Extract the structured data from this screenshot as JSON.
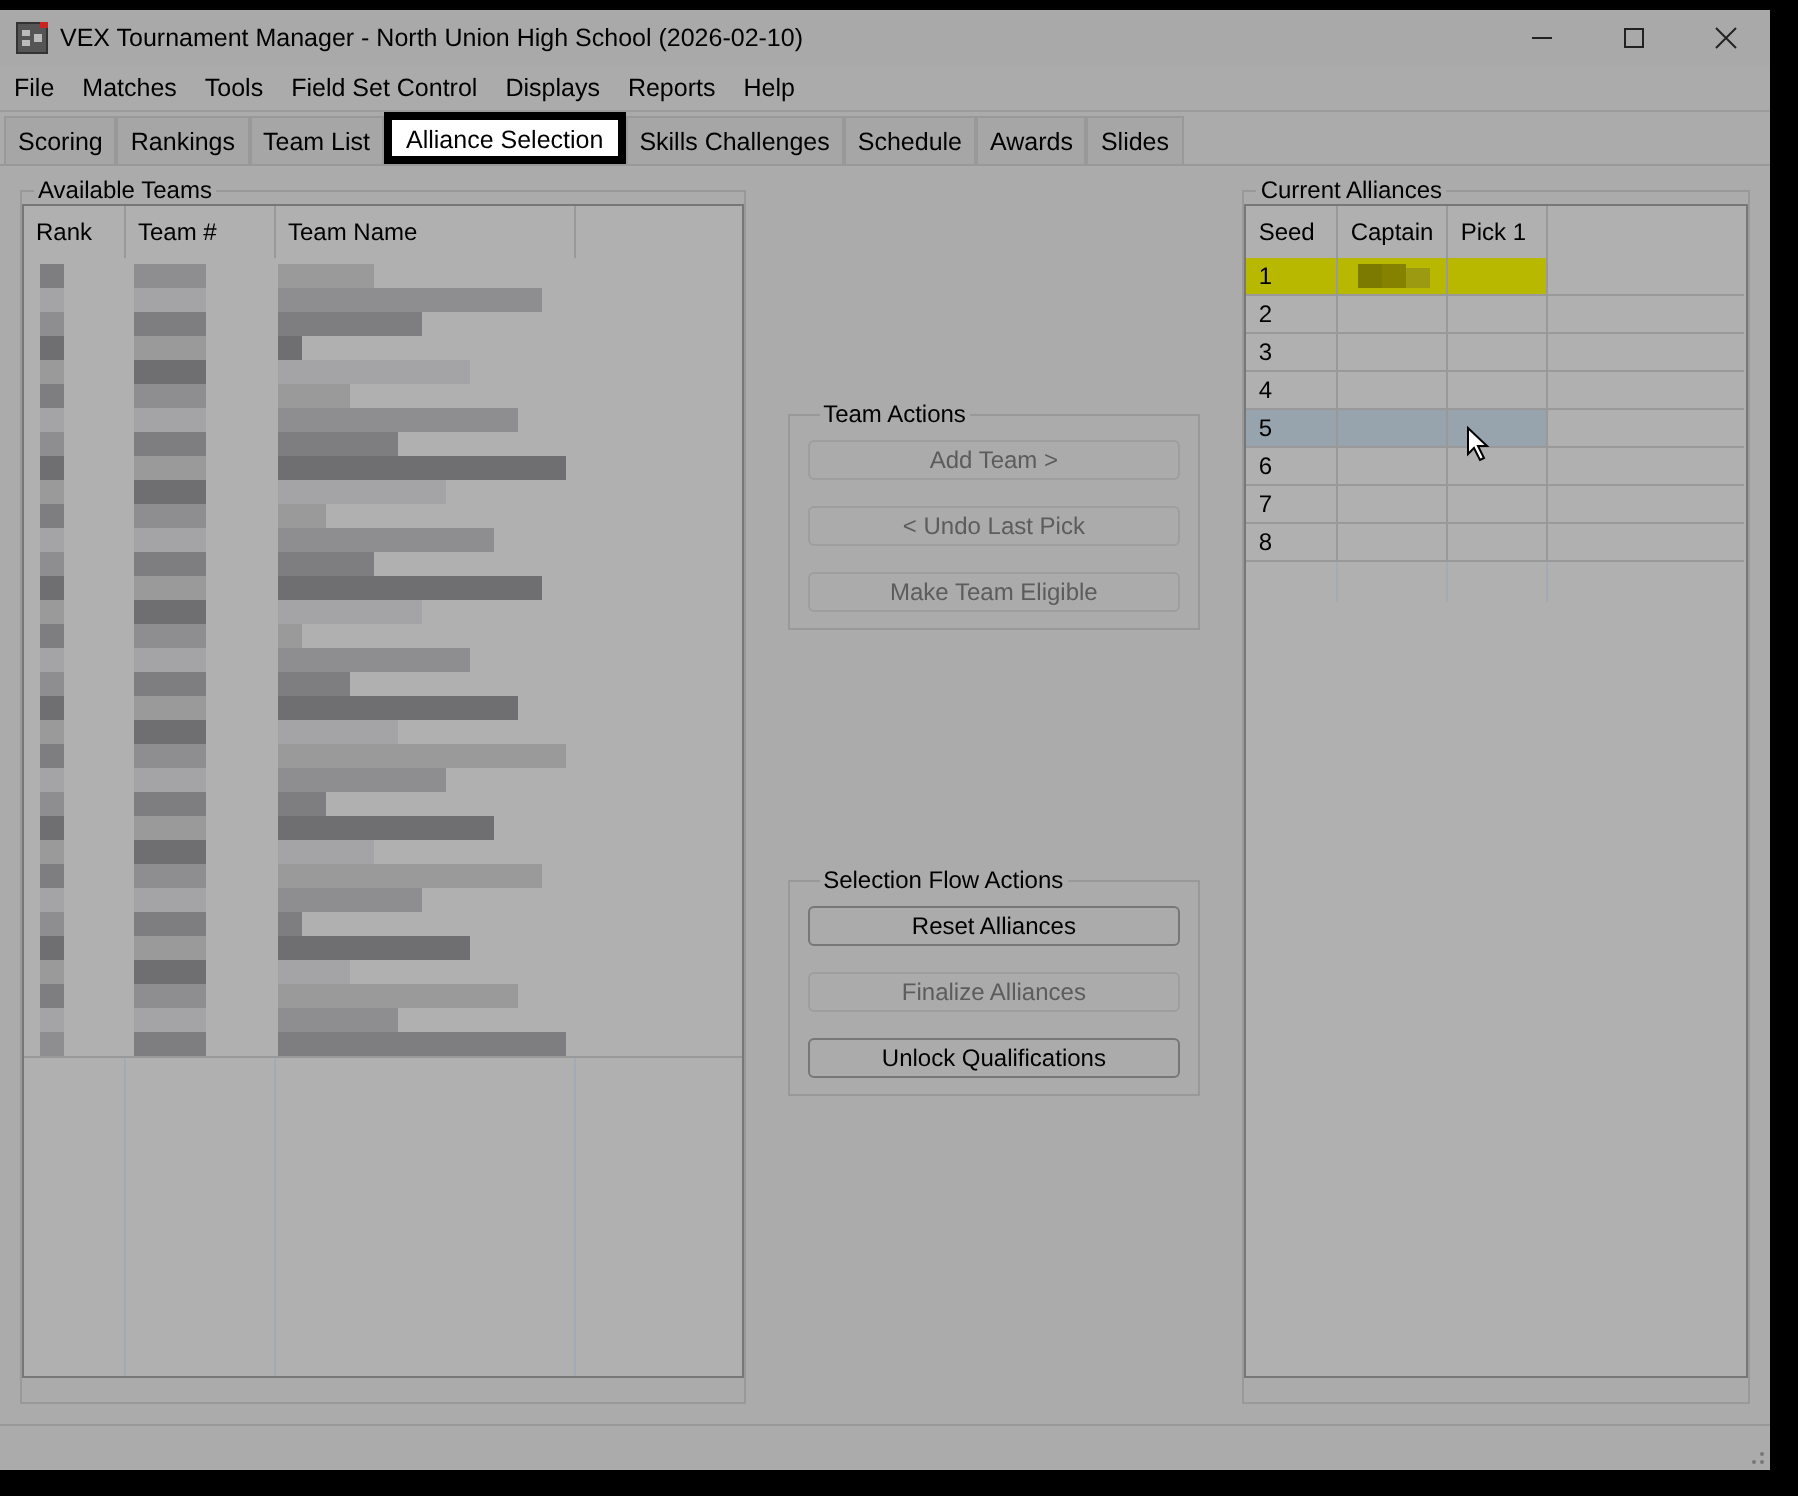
{
  "window": {
    "title": "VEX Tournament Manager - North Union High School (2026-02-10)"
  },
  "menu": [
    "File",
    "Matches",
    "Tools",
    "Field Set Control",
    "Displays",
    "Reports",
    "Help"
  ],
  "tabs": [
    {
      "label": "Scoring",
      "selected": false
    },
    {
      "label": "Rankings",
      "selected": false
    },
    {
      "label": "Team List",
      "selected": false
    },
    {
      "label": "Alliance Selection",
      "selected": true
    },
    {
      "label": "Skills Challenges",
      "selected": false
    },
    {
      "label": "Schedule",
      "selected": false
    },
    {
      "label": "Awards",
      "selected": false
    },
    {
      "label": "Slides",
      "selected": false
    }
  ],
  "available_teams": {
    "title": "Available Teams",
    "columns": [
      "Rank",
      "Team #",
      "Team Name"
    ]
  },
  "team_actions": {
    "title": "Team Actions",
    "buttons": [
      {
        "label": "Add Team >",
        "disabled": true
      },
      {
        "label": "< Undo Last Pick",
        "disabled": true
      },
      {
        "label": "Make Team Eligible",
        "disabled": true
      }
    ]
  },
  "selection_flow_actions": {
    "title": "Selection Flow Actions",
    "buttons": [
      {
        "label": "Reset Alliances",
        "disabled": false
      },
      {
        "label": "Finalize Alliances",
        "disabled": true
      },
      {
        "label": "Unlock Qualifications",
        "disabled": false
      }
    ]
  },
  "current_alliances": {
    "title": "Current Alliances",
    "columns": [
      "Seed",
      "Captain",
      "Pick 1"
    ],
    "rows": [
      {
        "seed": "1",
        "selected": true,
        "hovered": false,
        "captain_redacted": true
      },
      {
        "seed": "2",
        "selected": false,
        "hovered": false,
        "captain_redacted": false
      },
      {
        "seed": "3",
        "selected": false,
        "hovered": false,
        "captain_redacted": false
      },
      {
        "seed": "4",
        "selected": false,
        "hovered": false,
        "captain_redacted": false
      },
      {
        "seed": "5",
        "selected": false,
        "hovered": true,
        "captain_redacted": false
      },
      {
        "seed": "6",
        "selected": false,
        "hovered": false,
        "captain_redacted": false
      },
      {
        "seed": "7",
        "selected": false,
        "hovered": false,
        "captain_redacted": false
      },
      {
        "seed": "8",
        "selected": false,
        "hovered": false,
        "captain_redacted": false
      }
    ]
  }
}
